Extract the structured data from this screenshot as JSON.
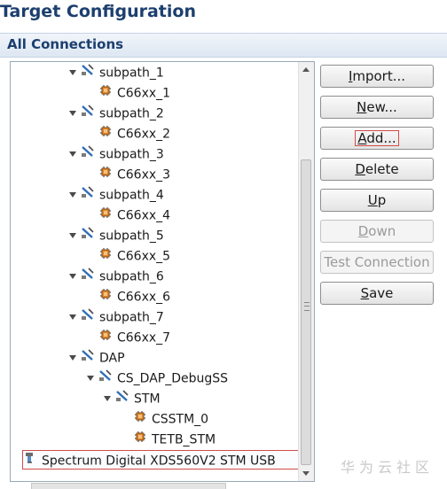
{
  "title": "Target Configuration",
  "section": "All Connections",
  "tree": [
    {
      "label": "subpath_1",
      "kind": "subpath",
      "expanded": true
    },
    {
      "label": "C66xx_1",
      "kind": "cpu"
    },
    {
      "label": "subpath_2",
      "kind": "subpath",
      "expanded": true
    },
    {
      "label": "C66xx_2",
      "kind": "cpu"
    },
    {
      "label": "subpath_3",
      "kind": "subpath",
      "expanded": true
    },
    {
      "label": "C66xx_3",
      "kind": "cpu"
    },
    {
      "label": "subpath_4",
      "kind": "subpath",
      "expanded": true
    },
    {
      "label": "C66xx_4",
      "kind": "cpu"
    },
    {
      "label": "subpath_5",
      "kind": "subpath",
      "expanded": true
    },
    {
      "label": "C66xx_5",
      "kind": "cpu"
    },
    {
      "label": "subpath_6",
      "kind": "subpath",
      "expanded": true
    },
    {
      "label": "C66xx_6",
      "kind": "cpu"
    },
    {
      "label": "subpath_7",
      "kind": "subpath",
      "expanded": true
    },
    {
      "label": "C66xx_7",
      "kind": "cpu"
    },
    {
      "label": "DAP",
      "kind": "subpath",
      "expanded": true
    },
    {
      "label": "CS_DAP_DebugSS",
      "kind": "subpath",
      "expanded": true
    },
    {
      "label": "STM",
      "kind": "subpath",
      "expanded": true
    },
    {
      "label": "CSSTM_0",
      "kind": "cpu"
    },
    {
      "label": "TETB_STM",
      "kind": "cpu"
    },
    {
      "label": "Spectrum Digital XDS560V2 STM USB",
      "kind": "connection",
      "selected": true
    }
  ],
  "buttons": {
    "import": {
      "pre": "",
      "u": "I",
      "post": "mport..."
    },
    "new": {
      "pre": "",
      "u": "N",
      "post": "ew..."
    },
    "add": {
      "pre": "",
      "u": "A",
      "post": "dd..."
    },
    "delete": {
      "pre": "",
      "u": "D",
      "post": "elete"
    },
    "up": {
      "pre": "",
      "u": "U",
      "post": "p"
    },
    "down": {
      "pre": "",
      "u": "D",
      "post": "own"
    },
    "test": {
      "label": "Test Connection"
    },
    "save": {
      "pre": "",
      "u": "S",
      "post": "ave"
    }
  },
  "watermark": "华为云社区",
  "colors": {
    "title": "#1c3f6e",
    "selection_outline": "#d24b4b",
    "icon_orange": "#e0852b",
    "icon_blue": "#2f6fb8"
  },
  "icons": {
    "subpath": "subpath-connector-icon",
    "cpu": "cpu-chip-icon",
    "connection": "usb-connection-icon"
  }
}
